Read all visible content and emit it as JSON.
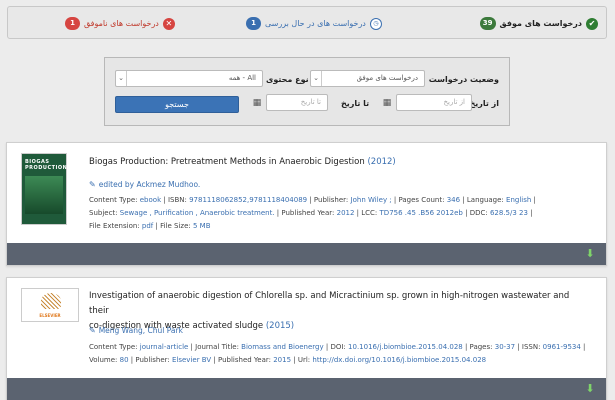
{
  "status": {
    "success": {
      "label": "درخواست های موفق",
      "count": "39",
      "icon": "check-circle-icon",
      "color": "#2e7d32"
    },
    "pending": {
      "label": "درخواست های در حال بررسی",
      "count": "1",
      "icon": "clock-icon",
      "color": "#3a6fb0"
    },
    "failed": {
      "label": "درخواست های ناموفق",
      "count": "1",
      "icon": "x-circle-icon",
      "color": "#d64541"
    }
  },
  "filter": {
    "status_label": "وضعیت درخواست",
    "status_value": "درخواست های موفق",
    "type_label": "نوع محتوی",
    "type_value": "All - همه",
    "from_label": "از تاریخ",
    "from_placeholder": "از تاریخ",
    "to_label": "تا تاریخ",
    "to_placeholder": "تا تاریخ",
    "search_label": "جستجو"
  },
  "results": [
    {
      "cover_text": "BIOGAS PRODUCTION",
      "title": "Biogas Production: Pretreatment Methods in Anaerobic Digestion",
      "year": "(2012)",
      "authors": "edited by Ackmez Mudhoo.",
      "meta_line1": {
        "content_type_label": "Content Type:",
        "content_type": "ebook",
        "isbn_label": "ISBN:",
        "isbn": "9781118062852,9781118404089",
        "publisher_label": "Publisher:",
        "publisher": "John Wiley ;",
        "pages_label": "Pages Count:",
        "pages": "346",
        "language_label": "Language:",
        "language": "English"
      },
      "meta_line2": {
        "subject_label": "Subject:",
        "subject": "Sewage , Purification , Anaerobic treatment.",
        "pub_year_label": "Published Year:",
        "pub_year": "2012",
        "lcc_label": "LCC:",
        "lcc": "TD756 .45 .B56 2012eb",
        "ddc_label": "DDC:",
        "ddc": "628.5/3 23"
      },
      "meta_line3": {
        "ext_label": "File Extension:",
        "ext": "pdf",
        "size_label": "File Size:",
        "size": "5 MB"
      }
    },
    {
      "cover_text": "ELSEVIER",
      "title_line1": "Investigation of anaerobic digestion of Chlorella sp. and Micractinium sp. grown in high-nitrogen wastewater and their",
      "title_line2": "co-digestion with waste activated sludge",
      "year": "(2015)",
      "authors": "Meng Wang, Chul Park",
      "meta_line1": {
        "content_type_label": "Content Type:",
        "content_type": "journal-article",
        "journal_label": "Journal Title:",
        "journal": "Biomass and Bioenergy",
        "doi_label": "DOI:",
        "doi": "10.1016/j.biombioe.2015.04.028",
        "pages_label": "Pages:",
        "pages": "30-37",
        "issn_label": "ISSN:",
        "issn": "0961-9534"
      },
      "meta_line2": {
        "volume_label": "Volume:",
        "volume": "80",
        "publisher_label": "Publisher:",
        "publisher": "Elsevier BV",
        "pub_year_label": "Published Year:",
        "pub_year": "2015",
        "url_label": "Url:",
        "url": "http://dx.doi.org/10.1016/j.biombioe.2015.04.028"
      }
    }
  ]
}
